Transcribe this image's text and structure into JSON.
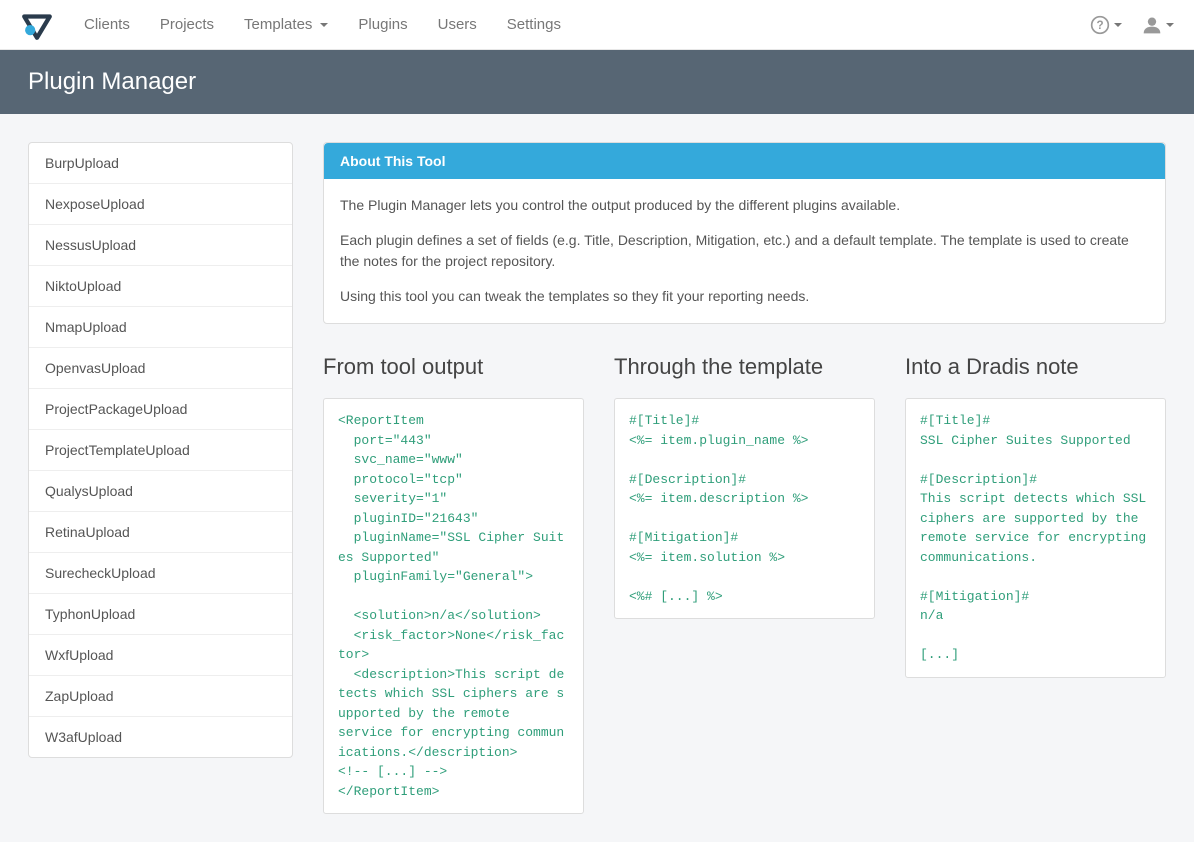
{
  "nav": {
    "items": [
      "Clients",
      "Projects",
      "Templates",
      "Plugins",
      "Users",
      "Settings"
    ]
  },
  "page_title": "Plugin Manager",
  "sidebar": {
    "items": [
      "BurpUpload",
      "NexposeUpload",
      "NessusUpload",
      "NiktoUpload",
      "NmapUpload",
      "OpenvasUpload",
      "ProjectPackageUpload",
      "ProjectTemplateUpload",
      "QualysUpload",
      "RetinaUpload",
      "SurecheckUpload",
      "TyphonUpload",
      "WxfUpload",
      "ZapUpload",
      "W3afUpload"
    ]
  },
  "about": {
    "heading": "About This Tool",
    "p1": "The Plugin Manager lets you control the output produced by the different plugins available.",
    "p2": "Each plugin defines a set of fields (e.g. Title, Description, Mitigation, etc.) and a default template. The template is used to create the notes for the project repository.",
    "p3": "Using this tool you can tweak the templates so they fit your reporting needs."
  },
  "columns": {
    "col1": {
      "title": "From tool output",
      "code": "<ReportItem\n  port=\"443\"\n  svc_name=\"www\"\n  protocol=\"tcp\"\n  severity=\"1\"\n  pluginID=\"21643\"\n  pluginName=\"SSL Cipher Suites Supported\"\n  pluginFamily=\"General\">\n\n  <solution>n/a</solution>\n  <risk_factor>None</risk_factor>\n  <description>This script detects which SSL ciphers are supported by the remote\nservice for encrypting communications.</description>\n<!-- [...] -->\n</ReportItem>"
    },
    "col2": {
      "title": "Through the template",
      "code": "#[Title]#\n<%= item.plugin_name %>\n\n#[Description]#\n<%= item.description %>\n\n#[Mitigation]#\n<%= item.solution %>\n\n<%# [...] %>"
    },
    "col3": {
      "title": "Into a Dradis note",
      "code": "#[Title]#\nSSL Cipher Suites Supported\n\n#[Description]#\nThis script detects which SSL ciphers are supported by the remote service for encrypting communications.\n\n#[Mitigation]#\nn/a\n\n[...]"
    }
  }
}
